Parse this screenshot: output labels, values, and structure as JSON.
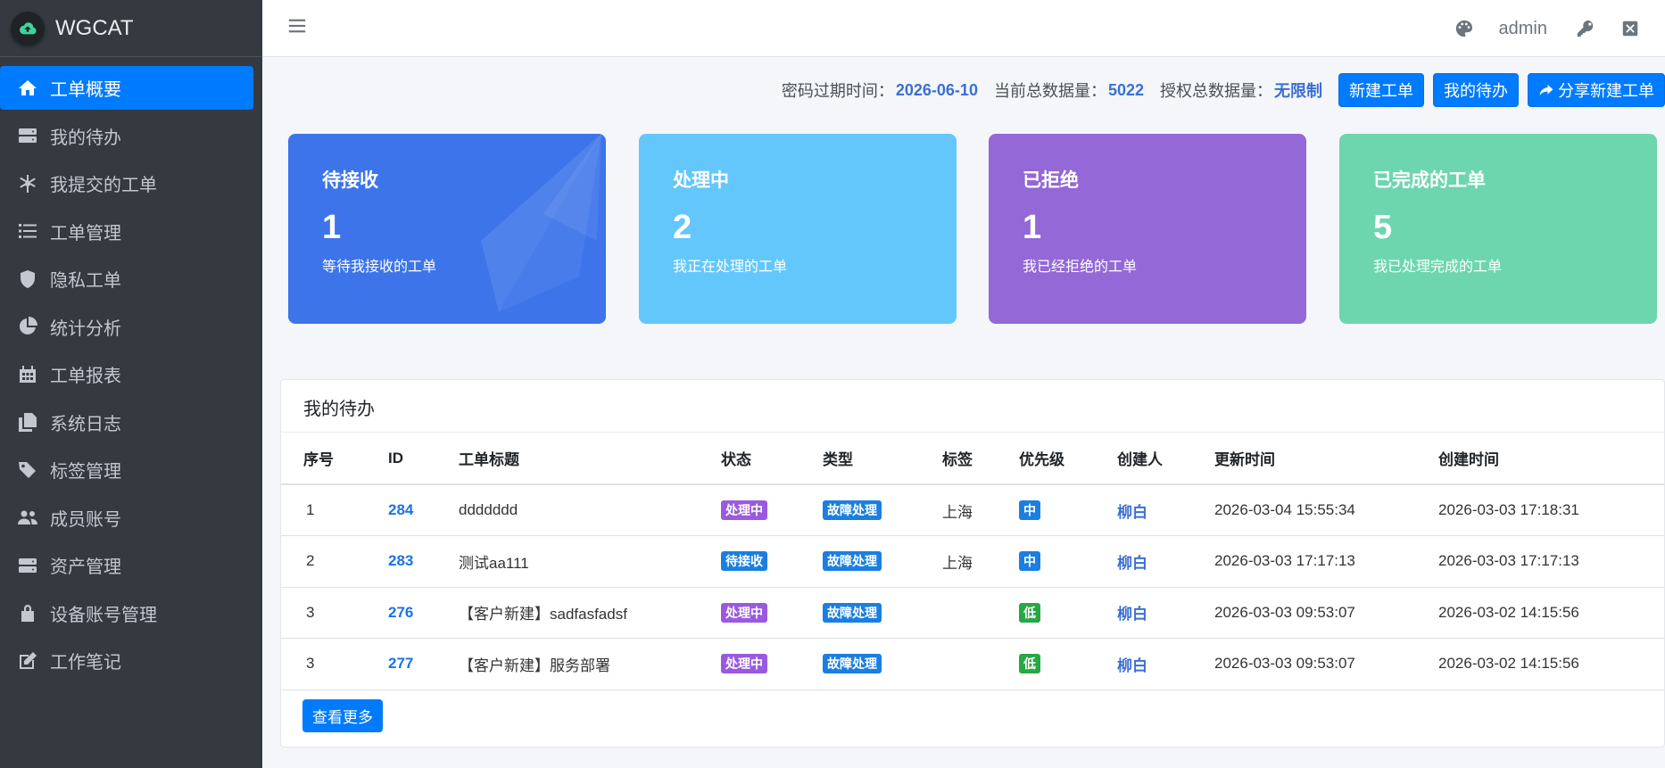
{
  "brand": {
    "name": "WGCAT"
  },
  "sidebar": {
    "items": [
      {
        "label": "工单概要",
        "icon": "home-icon",
        "active": true
      },
      {
        "label": "我的待办",
        "icon": "server-icon"
      },
      {
        "label": "我提交的工单",
        "icon": "snowflake-icon"
      },
      {
        "label": "工单管理",
        "icon": "list-icon"
      },
      {
        "label": "隐私工单",
        "icon": "shield-icon"
      },
      {
        "label": "统计分析",
        "icon": "pie-chart-icon"
      },
      {
        "label": "工单报表",
        "icon": "calendar-icon"
      },
      {
        "label": "系统日志",
        "icon": "copy-icon"
      },
      {
        "label": "标签管理",
        "icon": "tags-icon"
      },
      {
        "label": "成员账号",
        "icon": "users-icon"
      },
      {
        "label": "资产管理",
        "icon": "server-icon"
      },
      {
        "label": "设备账号管理",
        "icon": "lock-icon"
      },
      {
        "label": "工作笔记",
        "icon": "edit-icon"
      }
    ]
  },
  "topbar": {
    "user": "admin"
  },
  "info": {
    "pwd_label": "密码过期时间：",
    "pwd_value": "2026-06-10",
    "total_label": "当前总数据量：",
    "total_value": "5022",
    "license_label": "授权总数据量：",
    "license_value": "无限制",
    "btn_new": "新建工单",
    "btn_todo": "我的待办",
    "btn_share": "分享新建工单"
  },
  "cards": [
    {
      "title": "待接收",
      "count": "1",
      "desc": "等待我接收的工单",
      "color": "#3d74ea"
    },
    {
      "title": "处理中",
      "count": "2",
      "desc": "我正在处理的工单",
      "color": "#64c7fc"
    },
    {
      "title": "已拒绝",
      "count": "1",
      "desc": "我已经拒绝的工单",
      "color": "#9468d6"
    },
    {
      "title": "已完成的工单",
      "count": "5",
      "desc": "我已处理完成的工单",
      "color": "#6dd6ae"
    }
  ],
  "todo": {
    "title": "我的待办",
    "headers": [
      "序号",
      "ID",
      "工单标题",
      "状态",
      "类型",
      "标签",
      "优先级",
      "创建人",
      "更新时间",
      "创建时间"
    ],
    "rows": [
      {
        "seq": "1",
        "id": "284",
        "title": "ddddddd",
        "status": "处理中",
        "status_kind": "proc",
        "type": "故障处理",
        "tag": "上海",
        "priority": "中",
        "priority_kind": "mid",
        "creator": "柳白",
        "updated": "2026-03-04 15:55:34",
        "created": "2026-03-03 17:18:31"
      },
      {
        "seq": "2",
        "id": "283",
        "title": "测试aa111",
        "status": "待接收",
        "status_kind": "wait",
        "type": "故障处理",
        "tag": "上海",
        "priority": "中",
        "priority_kind": "mid",
        "creator": "柳白",
        "updated": "2026-03-03 17:17:13",
        "created": "2026-03-03 17:17:13"
      },
      {
        "seq": "3",
        "id": "276",
        "title": "【客户新建】sadfasfadsf",
        "status": "处理中",
        "status_kind": "proc",
        "type": "故障处理",
        "tag": "",
        "priority": "低",
        "priority_kind": "low",
        "creator": "柳白",
        "updated": "2026-03-03 09:53:07",
        "created": "2026-03-02 14:15:56"
      },
      {
        "seq": "3",
        "id": "277",
        "title": "【客户新建】服务部署",
        "status": "处理中",
        "status_kind": "proc",
        "type": "故障处理",
        "tag": "",
        "priority": "低",
        "priority_kind": "low",
        "creator": "柳白",
        "updated": "2026-03-03 09:53:07",
        "created": "2026-03-02 14:15:56"
      }
    ],
    "more": "查看更多"
  }
}
